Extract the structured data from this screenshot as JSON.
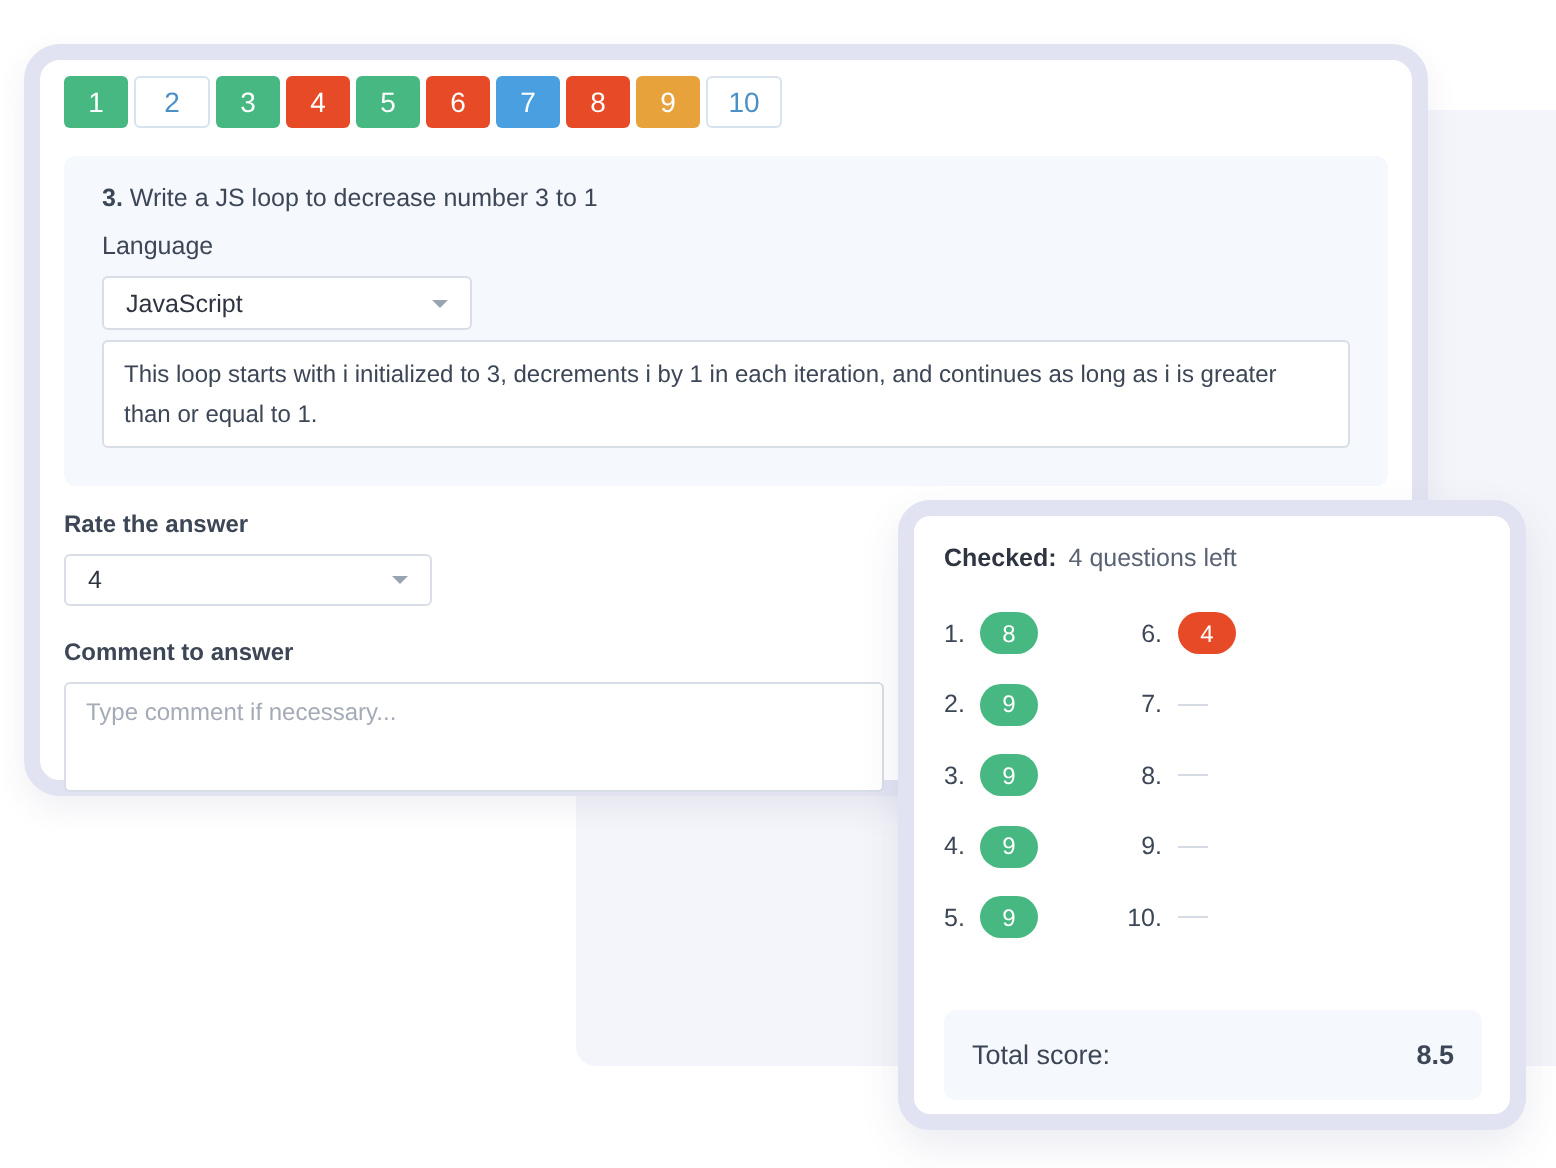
{
  "question_nav": [
    {
      "label": "1",
      "kind": "scored",
      "color": "#47b881"
    },
    {
      "label": "2",
      "kind": "open"
    },
    {
      "label": "3",
      "kind": "scored",
      "color": "#47b881"
    },
    {
      "label": "4",
      "kind": "scored",
      "color": "#e64a26"
    },
    {
      "label": "5",
      "kind": "scored",
      "color": "#47b881"
    },
    {
      "label": "6",
      "kind": "scored",
      "color": "#e64a26"
    },
    {
      "label": "7",
      "kind": "scored",
      "color": "#4a9fe0"
    },
    {
      "label": "8",
      "kind": "scored",
      "color": "#e64a26"
    },
    {
      "label": "9",
      "kind": "scored",
      "color": "#e8a23c"
    },
    {
      "label": "10",
      "kind": "open"
    }
  ],
  "question": {
    "number": "3.",
    "text": "Write a JS loop to decrease number 3 to 1",
    "language_label": "Language",
    "language": "JavaScript",
    "answer": "This loop starts with i initialized to 3, decrements i by 1 in each iteration, and continues as long as i is greater than or equal to 1."
  },
  "rating": {
    "label": "Rate the answer",
    "value": "4"
  },
  "comment": {
    "label": "Comment to answer",
    "placeholder": "Type comment if necessary..."
  },
  "summary": {
    "checked_label": "Checked:",
    "remaining": "4 questions left",
    "scores": [
      {
        "number": "1.",
        "kind": "scored",
        "score": "8",
        "color": "#47b881"
      },
      {
        "number": "2.",
        "kind": "scored",
        "score": "9",
        "color": "#47b881"
      },
      {
        "number": "3.",
        "kind": "scored",
        "score": "9",
        "color": "#47b881"
      },
      {
        "number": "4.",
        "kind": "scored",
        "score": "9",
        "color": "#47b881"
      },
      {
        "number": "5.",
        "kind": "scored",
        "score": "9",
        "color": "#47b881"
      },
      {
        "number": "6.",
        "kind": "scored",
        "score": "4",
        "color": "#e64a26"
      },
      {
        "number": "7.",
        "kind": "pending"
      },
      {
        "number": "8.",
        "kind": "pending"
      },
      {
        "number": "9.",
        "kind": "pending"
      },
      {
        "number": "10.",
        "kind": "pending"
      }
    ],
    "total_label": "Total score:",
    "total": "8.5"
  }
}
